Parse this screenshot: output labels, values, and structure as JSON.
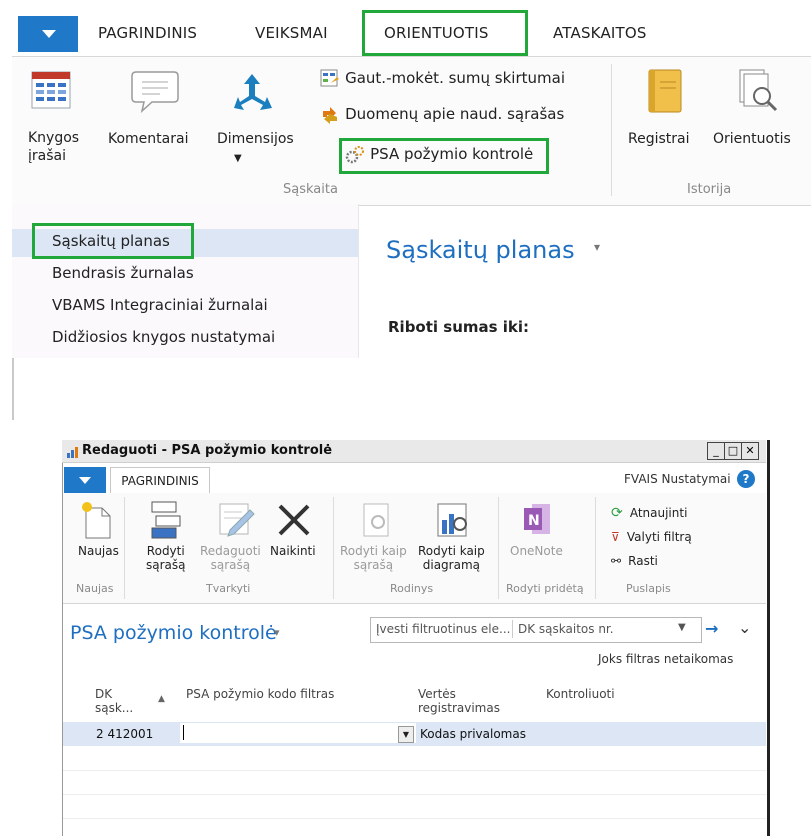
{
  "main": {
    "tabs": [
      "PAGRINDINIS",
      "VEIKSMAI",
      "ORIENTUOTIS",
      "ATASKAITOS"
    ],
    "ribbon": {
      "knygos_line1": "Knygos",
      "knygos_line2": "įrašai",
      "komentarai": "Komentarai",
      "dimensijos": "Dimensijos",
      "cmd1": "Gaut.-mokėt. sumų skirtumai",
      "cmd2": "Duomenų apie naud. sąrašas",
      "cmd3": "PSA požymio kontrolė",
      "group1": "Sąskaita",
      "registrai": "Registrai",
      "orientuotis": "Orientuotis",
      "group2": "Istorija"
    },
    "nav": {
      "items": [
        "Sąskaitų planas",
        "Bendrasis žurnalas",
        "VBAMS Integraciniai žurnalai",
        "Didžiosios knygos nustatymai"
      ]
    },
    "page_title": "Sąskaitų planas",
    "subheading": "Riboti sumas iki:",
    "accent": "#1f78c8",
    "highlight": "#22a83a"
  },
  "dialog": {
    "title": "Redaguoti - PSA požymio kontrolė",
    "tab": "PAGRINDINIS",
    "settings": "FVAIS Nustatymai",
    "buttons": {
      "naujas": "Naujas",
      "rodyti1": "Rodyti",
      "rodyti2": "sąrašą",
      "redaguoti1": "Redaguoti",
      "redaguoti2": "sąrašą",
      "naikinti": "Naikinti",
      "rks1": "Rodyti kaip",
      "rks2": "sąrašą",
      "rkd1": "Rodyti kaip",
      "rkd2": "diagramą",
      "onenote": "OneNote",
      "atnaujinti": "Atnaujinti",
      "valyti": "Valyti filtrą",
      "rasti": "Rasti"
    },
    "groups": {
      "naujas": "Naujas",
      "tvarkyti": "Tvarkyti",
      "rodinys": "Rodinys",
      "rodyti_pridetas": "Rodyti pridėtą",
      "puslapis": "Puslapis"
    },
    "page_title": "PSA požymio kontrolė",
    "filter_placeholder": "Įvesti filtruotinus ele...",
    "filter_field": "DK sąskaitos nr.",
    "no_filter": "Joks filtras netaikomas",
    "columns": {
      "dk1": "DK",
      "dk2": "sąsk...",
      "psa": "PSA požymio kodo filtras",
      "vertes1": "Vertės",
      "vertes2": "registravimas",
      "kontroliuoti": "Kontroliuoti"
    },
    "row": {
      "dk": "2 412001",
      "psa": "",
      "vertes": "Kodas privalomas",
      "kontroliuoti": ""
    }
  }
}
